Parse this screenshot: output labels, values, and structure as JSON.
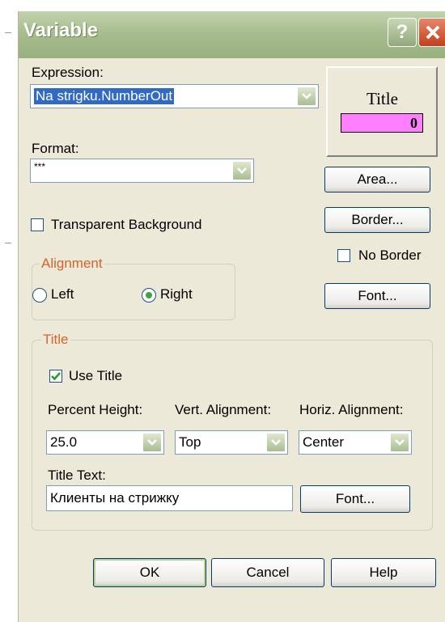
{
  "window": {
    "title": "Variable"
  },
  "expression": {
    "label": "Expression:",
    "value": "Na strigku.NumberOut"
  },
  "format": {
    "label": "Format:",
    "value": "***"
  },
  "transparent_background": {
    "label": "Transparent Background",
    "checked": false
  },
  "alignment": {
    "group_label": "Alignment",
    "left_label": "Left",
    "right_label": "Right",
    "selected": "Right"
  },
  "preview": {
    "title": "Title",
    "value": "0",
    "value_bg": "#FF80FF"
  },
  "buttons": {
    "area": "Area...",
    "border": "Border...",
    "font": "Font...",
    "title_font": "Font...",
    "ok": "OK",
    "cancel": "Cancel",
    "help": "Help"
  },
  "no_border": {
    "label": "No Border",
    "checked": false
  },
  "title_group": {
    "group_label": "Title",
    "use_title": {
      "label": "Use Title",
      "checked": true
    },
    "percent_height": {
      "label": "Percent Height:",
      "value": "25.0"
    },
    "vert_alignment": {
      "label": "Vert. Alignment:",
      "value": "Top"
    },
    "horiz_alignment": {
      "label": "Horiz. Alignment:",
      "value": "Center"
    },
    "title_text": {
      "label": "Title Text:",
      "value": "Клиенты на стрижку"
    }
  },
  "colors": {
    "accent": "#316AC5",
    "group_title": "#D8622A",
    "titlebar": "#A8BD8F"
  }
}
